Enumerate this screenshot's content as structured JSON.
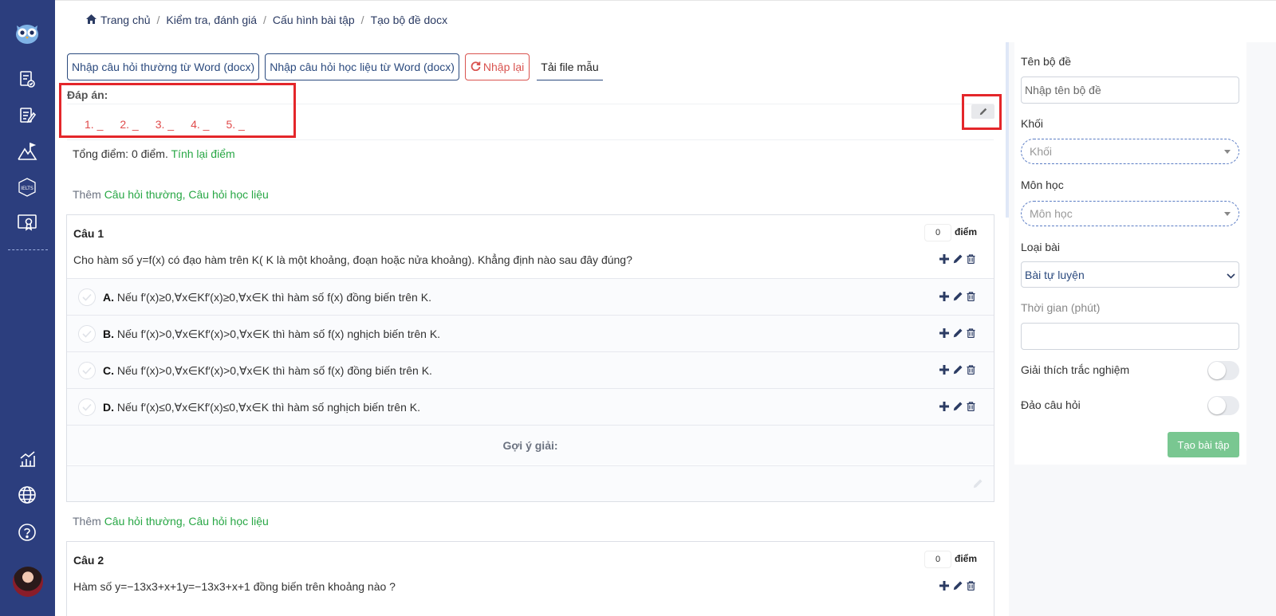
{
  "colors": {
    "sidebar": "#2c3e7e",
    "accent": "#2b4a7e",
    "green": "#28a745",
    "red": "#d9534f",
    "create_button": "#79c791"
  },
  "sidebar": {
    "icons": [
      "owl-logo-icon",
      "exam-check-icon",
      "edit-document-icon",
      "mountain-flag-icon",
      "ielts-icon",
      "certificate-icon",
      "chart-icon",
      "globe-icon",
      "help-icon"
    ]
  },
  "breadcrumb": {
    "home": "Trang chủ",
    "items": [
      "Kiểm tra, đánh giá",
      "Cấu hình bài tập",
      "Tạo bộ đề docx"
    ],
    "separator": "/"
  },
  "toolbar": {
    "import_normal": "Nhập câu hỏi thường từ Word (docx)",
    "import_material": "Nhập câu hỏi học liệu từ Word (docx)",
    "reset": "Nhập lại",
    "download_template": "Tải file mẫu"
  },
  "answers": {
    "label": "Đáp án:",
    "items": [
      "1. _",
      "2. _",
      "3. _",
      "4. _",
      "5. _"
    ]
  },
  "score": {
    "prefix": "Tổng điểm: ",
    "value": "0",
    "suffix": " điểm.",
    "recalc": "Tính lại điểm"
  },
  "add": {
    "prefix": "Thêm ",
    "links": "Câu hỏi thường, Câu hỏi học liệu"
  },
  "questions": [
    {
      "title": "Câu 1",
      "points": "0",
      "points_label": "điểm",
      "text": "Cho hàm số y=f(x) có đạo hàm trên K( K là một khoảng, đoạn hoặc nửa khoảng). Khẳng định nào sau đây đúng?",
      "options": [
        {
          "letter": "A.",
          "text": "Nếu f′(x)≥0,∀x∈Kf′(x)≥0,∀x∈K thì hàm số f(x) đồng biến trên K."
        },
        {
          "letter": "B.",
          "text": "Nếu f′(x)>0,∀x∈Kf′(x)>0,∀x∈K thì hàm số f(x) nghịch biến trên K."
        },
        {
          "letter": "C.",
          "text": "Nếu f′(x)>0,∀x∈Kf′(x)>0,∀x∈K thì hàm số f(x) đồng biến trên K."
        },
        {
          "letter": "D.",
          "text": "Nếu f′(x)≤0,∀x∈Kf′(x)≤0,∀x∈K thì hàm số nghịch biến trên K."
        }
      ],
      "hint_label": "Gợi ý giải:"
    },
    {
      "title": "Câu 2",
      "points": "0",
      "points_label": "điểm",
      "text": "Hàm số y=−13x3+x+1y=−13x3+x+1 đồng biến trên khoảng nào ?"
    }
  ],
  "panel": {
    "name_label": "Tên bộ đề",
    "name_placeholder": "Nhập tên bộ đề",
    "grade_label": "Khối",
    "grade_placeholder": "Khối",
    "subject_label": "Môn học",
    "subject_placeholder": "Môn học",
    "type_label": "Loại bài",
    "type_value": "Bài tự luyện",
    "time_label": "Thời gian (phút)",
    "time_value": "",
    "explain_label": "Giải thích trắc nghiệm",
    "explain_on": false,
    "shuffle_label": "Đảo câu hỏi",
    "shuffle_on": false,
    "create_button": "Tạo bài tập"
  }
}
